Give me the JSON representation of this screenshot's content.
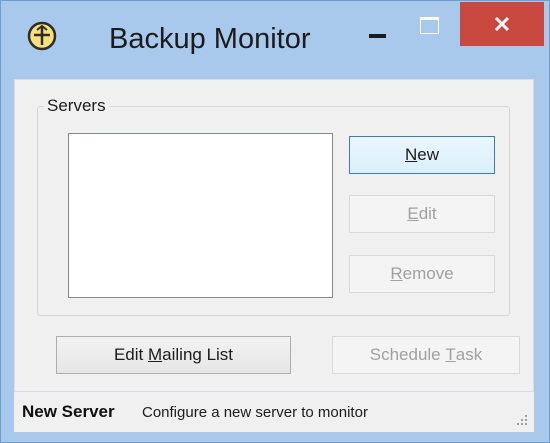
{
  "window": {
    "title": "Backup Monitor",
    "app_icon": "backup-logo-icon",
    "controls": {
      "minimize_icon": "minimize-icon",
      "maximize_icon": "maximize-icon",
      "close_icon": "close-icon",
      "close_color": "#c9483f"
    },
    "frame_color": "#a9c9ec"
  },
  "servers_group": {
    "label": "Servers",
    "items": []
  },
  "buttons": {
    "new": {
      "mnemonic": "N",
      "rest": "ew",
      "enabled": true
    },
    "edit": {
      "mnemonic": "E",
      "rest": "dit",
      "enabled": false
    },
    "remove": {
      "mnemonic": "R",
      "rest": "emove",
      "enabled": false
    },
    "mailing": {
      "prefix": "Edit ",
      "mnemonic": "M",
      "rest": "ailing List",
      "enabled": true
    },
    "schedule": {
      "prefix": "Schedule ",
      "mnemonic": "T",
      "rest": "ask",
      "enabled": false
    }
  },
  "status": {
    "title": "New Server",
    "description": "Configure a new server to monitor"
  }
}
